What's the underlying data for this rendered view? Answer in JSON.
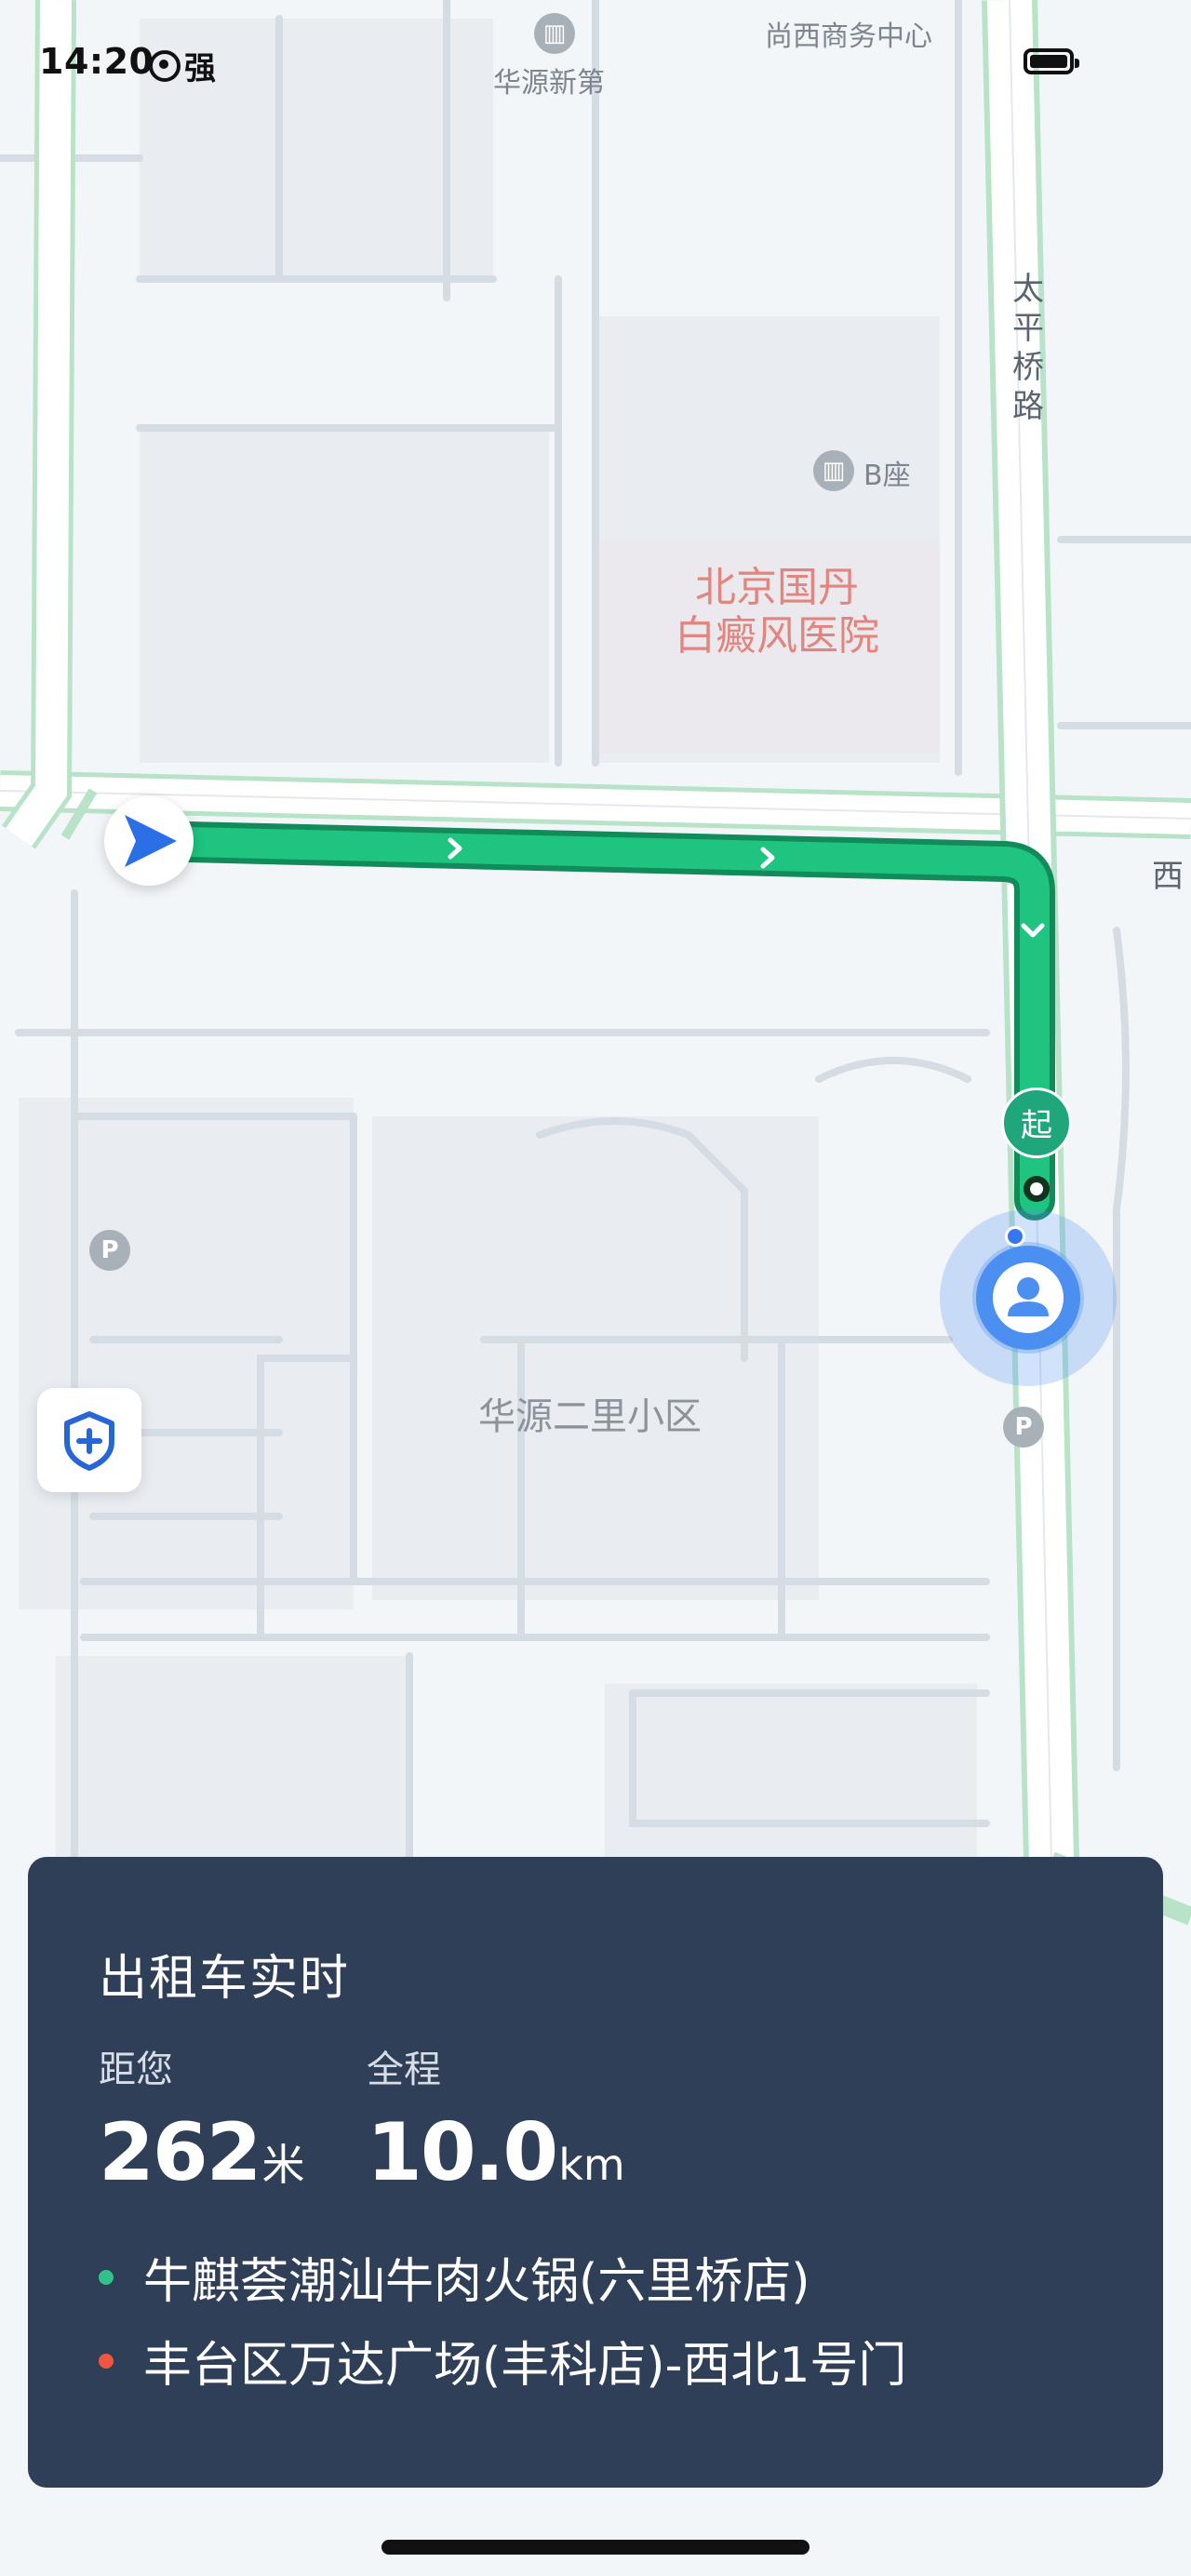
{
  "status_bar": {
    "time": "14:20",
    "network": "强"
  },
  "map": {
    "labels": {
      "huayuan_xindi": "华源新第",
      "shangxi_center": "尚西商务中心",
      "taiping_road": "太平桥路",
      "b_building": "B座",
      "hospital": "北京国丹\n白癜风医院",
      "huayuan_erli": "华源二里小区",
      "xi_edge": "西"
    },
    "start_marker": "起",
    "parking": "P"
  },
  "card": {
    "title": "出租车实时",
    "distance": {
      "label": "距您",
      "value": "262",
      "unit": "米"
    },
    "total": {
      "label": "全程",
      "value": "10.0",
      "unit": "km"
    },
    "origin": "牛麒荟潮汕牛肉火锅(六里桥店)",
    "destination": "丰台区万达广场(丰科店)-西北1号门",
    "colors": {
      "origin_dot": "#33c08a",
      "destination_dot": "#f0553f",
      "card_bg": "#2f3f58",
      "route": "#1ec47f"
    }
  }
}
